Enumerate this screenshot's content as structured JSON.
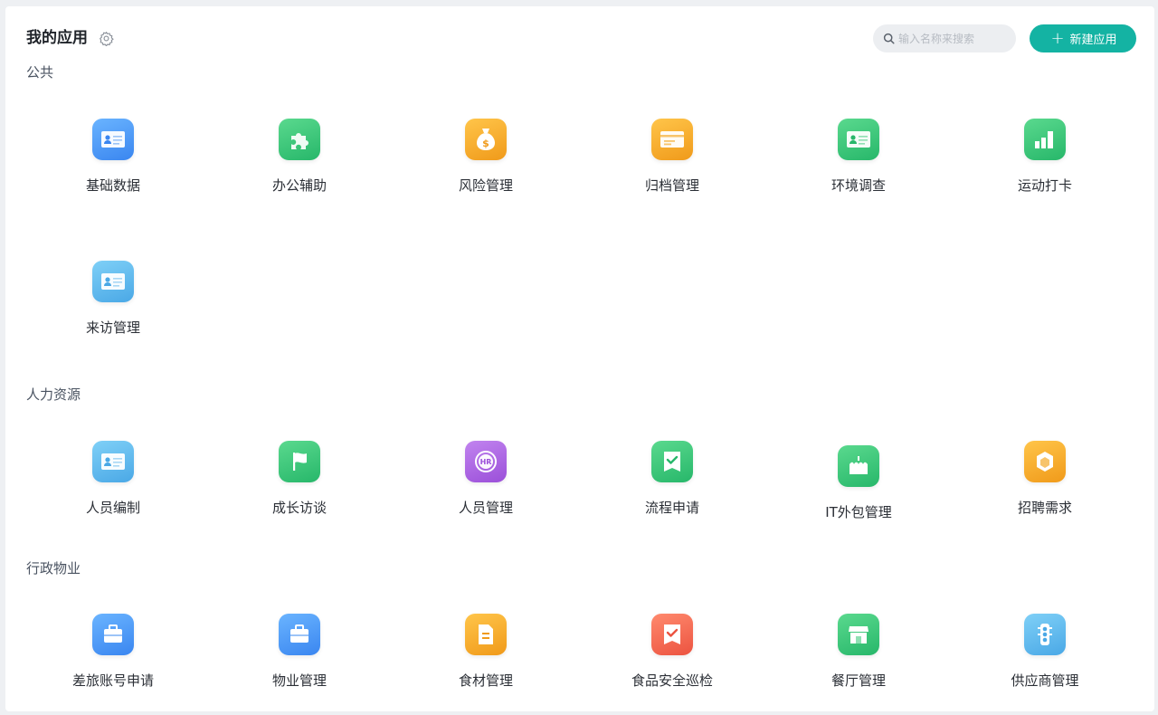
{
  "header": {
    "title": "我的应用",
    "search_placeholder": "输入名称来搜索",
    "new_button_label": "新建应用"
  },
  "colors": {
    "accent": "#14b3a3",
    "blue": "#3a86f0",
    "light_blue": "#4aa8e6",
    "green": "#27b76a",
    "orange": "#f09a1a",
    "purple": "#9b4fd9",
    "red": "#ec5340"
  },
  "sections": [
    {
      "title": "公共",
      "apps": [
        {
          "label": "基础数据",
          "icon": "id-card-icon",
          "color": "blue"
        },
        {
          "label": "办公辅助",
          "icon": "puzzle-icon",
          "color": "green"
        },
        {
          "label": "风险管理",
          "icon": "money-bag-icon",
          "color": "orange"
        },
        {
          "label": "归档管理",
          "icon": "card-icon",
          "color": "orange"
        },
        {
          "label": "环境调查",
          "icon": "id-card-icon",
          "color": "green"
        },
        {
          "label": "运动打卡",
          "icon": "bar-chart-icon",
          "color": "green"
        },
        {
          "label": "来访管理",
          "icon": "id-card-icon",
          "color": "light_blue"
        }
      ]
    },
    {
      "title": "人力资源",
      "apps": [
        {
          "label": "人员编制",
          "icon": "id-card-icon",
          "color": "light_blue"
        },
        {
          "label": "成长访谈",
          "icon": "flag-icon",
          "color": "green"
        },
        {
          "label": "人员管理",
          "icon": "hr-badge-icon",
          "color": "purple",
          "icon_text": "HR"
        },
        {
          "label": "流程申请",
          "icon": "check-ribbon-icon",
          "color": "green"
        },
        {
          "label": "IT外包管理",
          "icon": "cake-icon",
          "color": "green"
        },
        {
          "label": "招聘需求",
          "icon": "cube-icon",
          "color": "orange"
        }
      ]
    },
    {
      "title": "行政物业",
      "apps": [
        {
          "label": "差旅账号申请",
          "icon": "briefcase-icon",
          "color": "blue"
        },
        {
          "label": "物业管理",
          "icon": "briefcase-icon",
          "color": "blue"
        },
        {
          "label": "食材管理",
          "icon": "document-icon",
          "color": "orange"
        },
        {
          "label": "食品安全巡检",
          "icon": "check-ribbon-icon",
          "color": "red"
        },
        {
          "label": "餐厅管理",
          "icon": "store-icon",
          "color": "green"
        },
        {
          "label": "供应商管理",
          "icon": "traffic-light-icon",
          "color": "light_blue"
        }
      ]
    }
  ]
}
